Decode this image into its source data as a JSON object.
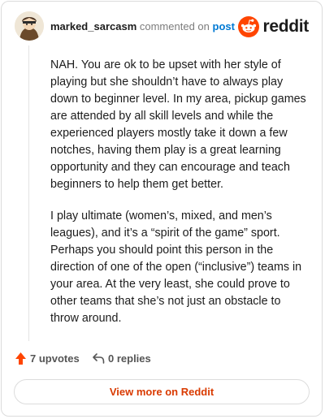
{
  "comment": {
    "username": "marked_sarcasm",
    "action_text": "commented on",
    "post_link": "post",
    "paragraphs": [
      "NAH. You are ok to be upset with her style of playing but she shouldn’t have to always play down to beginner level. In my area, pickup games are attended by all skill levels and while the experienced players mostly take it down a few notches, having them play is a great learning opportunity and they can encourage and teach beginners to help them get better.",
      "I play ultimate (women’s, mixed, and men’s leagues), and it’s a “spirit of the game” sport. Perhaps you should point this person in the direction of one of the open (“inclusive”) teams in your area. At the very least, she could prove to other teams that she’s not just an obstacle to throw around."
    ]
  },
  "brand": {
    "wordmark": "reddit",
    "accent_color": "#ff4500",
    "link_color": "#0079d3"
  },
  "actions": {
    "upvotes_label": "7 upvotes",
    "replies_label": "0 replies",
    "upvote_icon": "upvote-arrow-icon",
    "reply_icon": "reply-arrow-icon"
  },
  "footer": {
    "view_more_label": "View more on Reddit",
    "view_more_color": "#d93a00"
  }
}
